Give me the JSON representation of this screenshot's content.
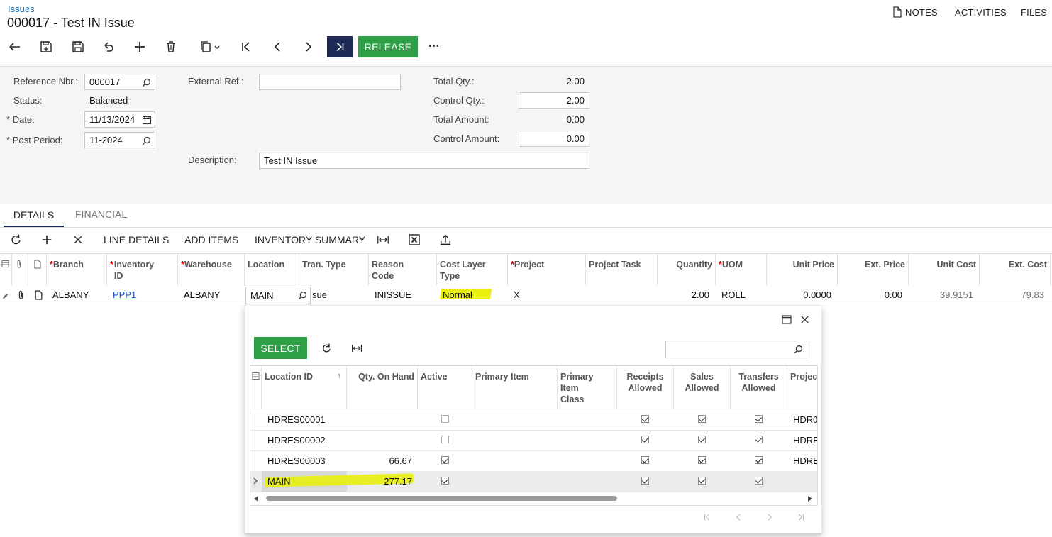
{
  "header": {
    "breadcrumb": "Issues",
    "title": "000017 - Test IN Issue",
    "notes": "NOTES",
    "activities": "ACTIVITIES",
    "files": "FILES"
  },
  "toolbar": {
    "release_label": "RELEASE",
    "more_label": "···"
  },
  "form": {
    "reference_nbr": {
      "label": "Reference Nbr.:",
      "value": "000017"
    },
    "status": {
      "label": "Status:",
      "value": "Balanced"
    },
    "date": {
      "label": "Date:",
      "value": "11/13/2024"
    },
    "post_period": {
      "label": "Post Period:",
      "value": "11-2024"
    },
    "external_ref": {
      "label": "External Ref.:",
      "value": ""
    },
    "description": {
      "label": "Description:",
      "value": "Test IN Issue"
    },
    "total_qty": {
      "label": "Total Qty.:",
      "value": "2.00"
    },
    "control_qty": {
      "label": "Control Qty.:",
      "value": "2.00"
    },
    "total_amount": {
      "label": "Total Amount:",
      "value": "0.00"
    },
    "control_amount": {
      "label": "Control Amount:",
      "value": "0.00"
    },
    "required_mark": "*"
  },
  "tabs": [
    {
      "label": "DETAILS",
      "active": true
    },
    {
      "label": "FINANCIAL",
      "active": false
    }
  ],
  "grid_toolbar": {
    "line_details": "LINE DETAILS",
    "add_items": "ADD ITEMS",
    "inventory_summary": "INVENTORY SUMMARY"
  },
  "grid": {
    "columns": [
      "Branch",
      "Inventory ID",
      "Warehouse",
      "Location",
      "Tran. Type",
      "Reason Code",
      "Cost Layer Type",
      "Project",
      "Project Task",
      "Quantity",
      "UOM",
      "Unit Price",
      "Ext. Price",
      "Unit Cost",
      "Ext. Cost"
    ],
    "row": {
      "branch": "ALBANY",
      "inventory_id": "PPP1",
      "warehouse": "ALBANY",
      "location": "MAIN",
      "tran_type": "sue",
      "reason_code": "INISSUE",
      "cost_layer_type": "Normal",
      "project": "X",
      "project_task": "",
      "quantity": "2.00",
      "uom": "ROLL",
      "unit_price": "0.0000",
      "ext_price": "0.00",
      "unit_cost": "39.9151",
      "ext_cost": "79.83"
    }
  },
  "lookup": {
    "select_label": "SELECT",
    "search_placeholder": "",
    "columns": [
      "Location ID",
      "Qty. On Hand",
      "Active",
      "Primary Item",
      "Primary Item Class",
      "Receipts Allowed",
      "Sales Allowed",
      "Transfers Allowed",
      "Projec"
    ],
    "rows": [
      {
        "location_id": "HDRES00001",
        "qty": "",
        "active": false,
        "receipts": true,
        "sales": true,
        "transfers": true,
        "project": "HDR0"
      },
      {
        "location_id": "HDRES00002",
        "qty": "",
        "active": false,
        "receipts": true,
        "sales": true,
        "transfers": true,
        "project": "HDRE"
      },
      {
        "location_id": "HDRES00003",
        "qty": "66.67",
        "active": true,
        "receipts": true,
        "sales": true,
        "transfers": true,
        "project": "HDRE"
      },
      {
        "location_id": "MAIN",
        "qty": "277.17",
        "active": true,
        "receipts": true,
        "sales": true,
        "transfers": true,
        "project": "",
        "selected": true
      }
    ]
  },
  "colors": {
    "accent_blue": "#1a6fb5",
    "release_green": "#2e9e47",
    "dark_nav": "#1c2a55",
    "highlight_yellow": "#e8f00c"
  }
}
